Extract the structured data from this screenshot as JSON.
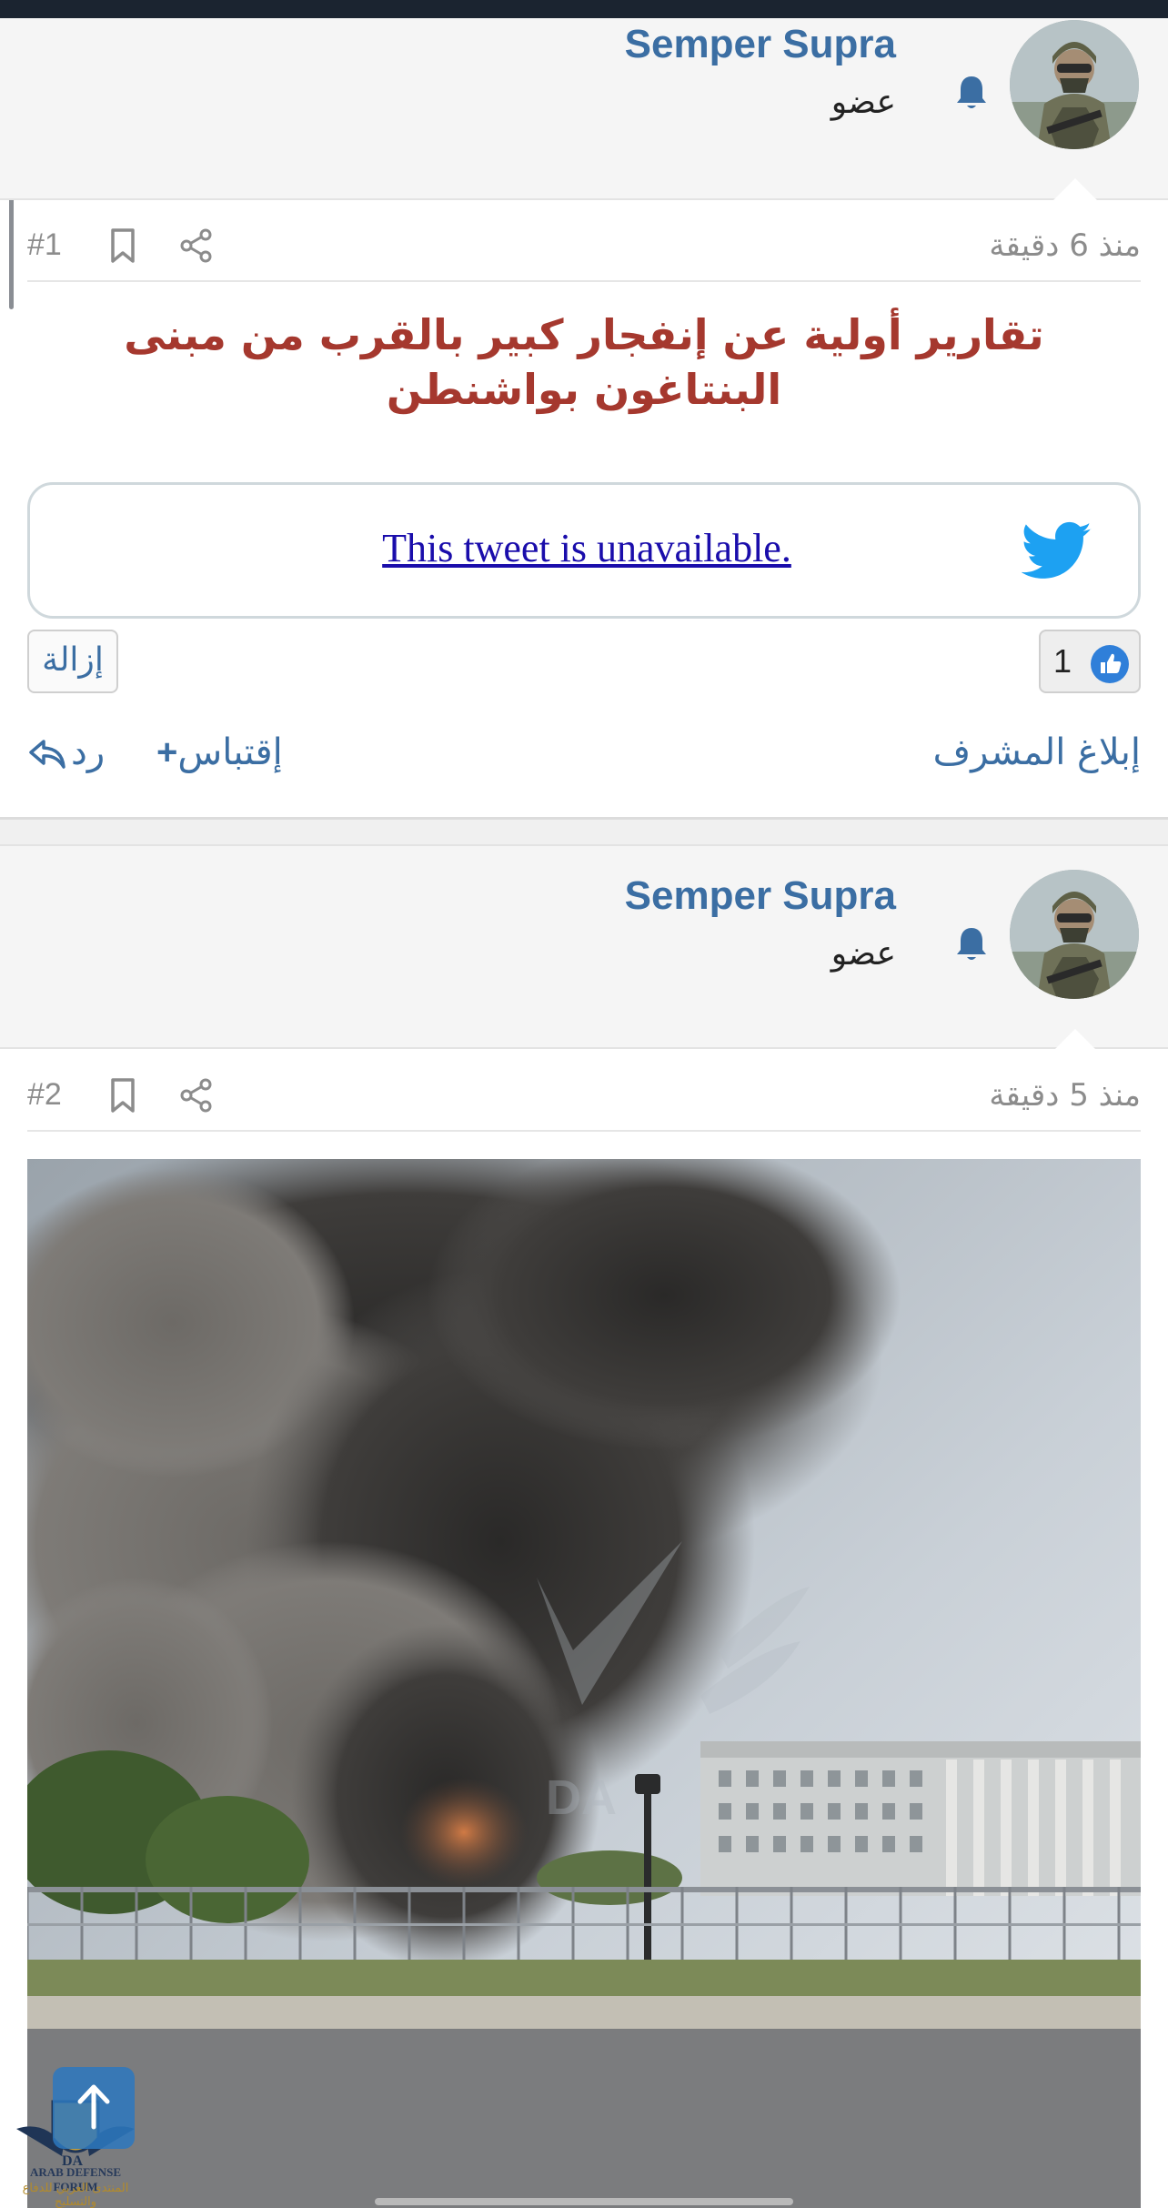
{
  "posts": [
    {
      "author": "Semper Supra",
      "role": "عضو",
      "time": "منذ 6 دقيقة",
      "number": "#1",
      "title": "تقارير أولية عن إنفجار كبير بالقرب من مبنى البنتاغون بواشنطن",
      "embed": {
        "text": "This tweet is unavailable.",
        "icon": "twitter-bird-icon"
      },
      "reaction_count": "1",
      "remove_label": "إزالة",
      "report_label": "إبلاغ المشرف",
      "quote_label": "إقتباس",
      "reply_label": "رد"
    },
    {
      "author": "Semper Supra",
      "role": "عضو",
      "time": "منذ 5 دقيقة",
      "number": "#2",
      "image_watermark": "DA"
    }
  ],
  "forum_logo": {
    "mark": "DA",
    "name_en": "ARAB DEFENSE FORUM",
    "name_ar": "المنتدى العربي للدفاع والتسليح"
  },
  "colors": {
    "link": "#3b6ea3",
    "title": "#a5382e",
    "muted": "#8c8c8c",
    "twitter": "#1da1f2"
  }
}
